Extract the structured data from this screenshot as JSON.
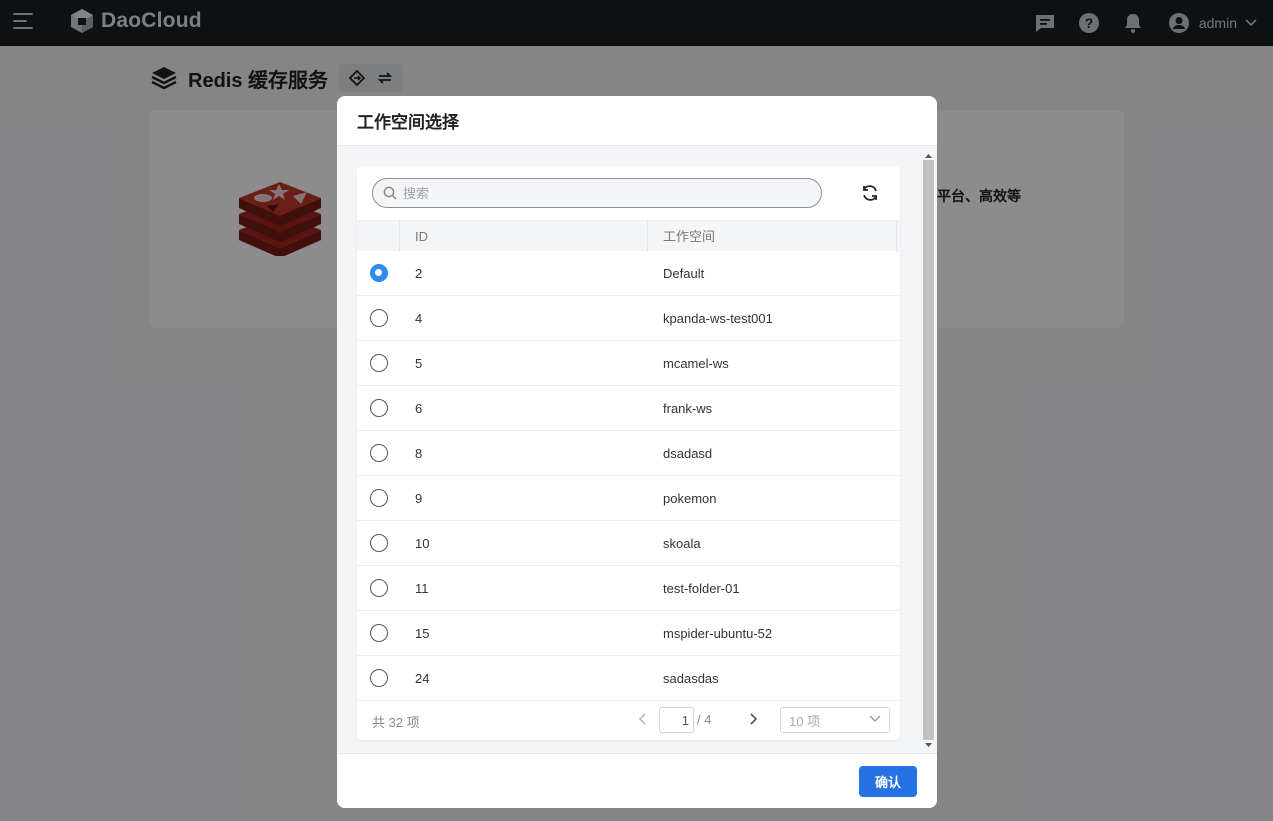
{
  "app": {
    "brand": "DaoCloud",
    "user": "admin",
    "icons": [
      "menu-icon",
      "message-icon",
      "help-icon",
      "bell-icon",
      "user-avatar-icon",
      "chevron-down-icon"
    ]
  },
  "page": {
    "title": "Redis 缓存服务",
    "card_text": "平台、高效等"
  },
  "modal": {
    "title": "工作空间选择",
    "search_placeholder": "搜索",
    "columns": {
      "id": "ID",
      "workspace": "工作空间"
    },
    "rows": [
      {
        "id": "2",
        "workspace": "Default",
        "selected": true
      },
      {
        "id": "4",
        "workspace": "kpanda-ws-test001",
        "selected": false
      },
      {
        "id": "5",
        "workspace": "mcamel-ws",
        "selected": false
      },
      {
        "id": "6",
        "workspace": "frank-ws",
        "selected": false
      },
      {
        "id": "8",
        "workspace": "dsadasd",
        "selected": false
      },
      {
        "id": "9",
        "workspace": "pokemon",
        "selected": false
      },
      {
        "id": "10",
        "workspace": "skoala",
        "selected": false
      },
      {
        "id": "11",
        "workspace": "test-folder-01",
        "selected": false
      },
      {
        "id": "15",
        "workspace": "mspider-ubuntu-52",
        "selected": false
      },
      {
        "id": "24",
        "workspace": "sadasdas",
        "selected": false
      }
    ],
    "pagination": {
      "total_label": "共 32 项",
      "current_page": "1",
      "page_count_label": "/ 4",
      "page_size_label": "10 项"
    },
    "confirm_label": "确认"
  },
  "colors": {
    "primary": "#2672e4",
    "radio_selected": "#2c8cf0",
    "topbar": "#1c1e22",
    "redis_red": "#a4271f"
  }
}
